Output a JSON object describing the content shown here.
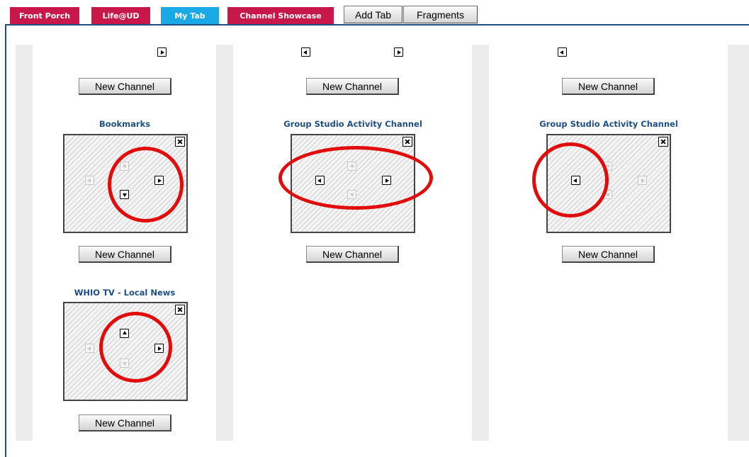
{
  "tabs": [
    {
      "label": "Front Porch"
    },
    {
      "label": "Life@UD"
    },
    {
      "label": "My Tab",
      "active": true
    },
    {
      "label": "Channel Showcase"
    }
  ],
  "tab_buttons": {
    "add_tab": "Add Tab",
    "fragments": "Fragments"
  },
  "buttons": {
    "new_channel": "New Channel"
  },
  "channels": [
    {
      "title": "Bookmarks"
    },
    {
      "title": "WHIO TV - Local News"
    },
    {
      "title": "Group Studio Activity Channel"
    },
    {
      "title": "Group Studio Activity Channel"
    }
  ],
  "colors": {
    "tab_red": "#c8184a",
    "tab_active": "#1ba9e6",
    "title_blue": "#1f4e85",
    "annotation_red": "#e10d0d"
  },
  "icons": {
    "move_left": "arrow-left-icon",
    "move_right": "arrow-right-icon",
    "move_up": "arrow-up-icon",
    "move_down": "arrow-down-icon",
    "remove": "close-icon"
  }
}
